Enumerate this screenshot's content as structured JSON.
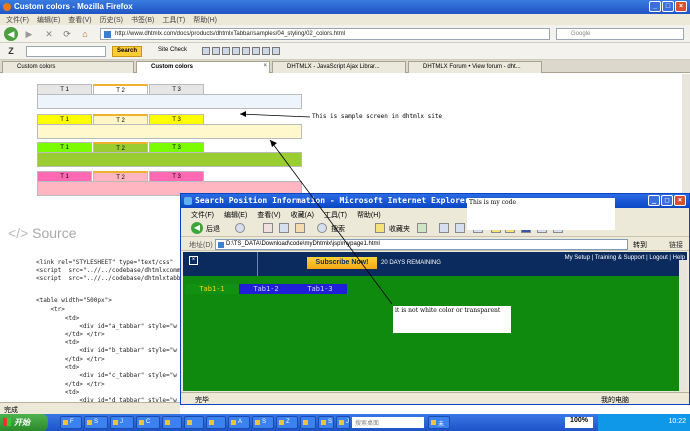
{
  "firefox": {
    "title": "Custom colors - Mozilla Firefox",
    "menu": [
      "文件(F)",
      "编辑(E)",
      "查看(V)",
      "历史(S)",
      "书签(B)",
      "工具(T)",
      "帮助(H)"
    ],
    "url": "http://www.dhtmlx.com/docs/products/dhtmlxTabbar/samples/04_styling/02_colors.html",
    "search_placeholder": "Google",
    "toolbar": {
      "search_button": "Search",
      "site_check": "Site Check"
    },
    "tabs": [
      {
        "label": "Custom colors",
        "active": false
      },
      {
        "label": "Custom colors",
        "active": true
      },
      {
        "label": "DHTMLX - JavaScript Ajax Librar...",
        "active": false
      },
      {
        "label": "DHTMLX Forum • View forum - dht...",
        "active": false
      }
    ],
    "status": "完成"
  },
  "page": {
    "sample_tabbars": [
      {
        "tabs": [
          "T 1",
          "T 2",
          "T 3"
        ],
        "tab_color": "#e6e6e6",
        "active_tab": "#ffffff",
        "body_color": "#eef4fb"
      },
      {
        "tabs": [
          "T 1",
          "T 2",
          "T 3"
        ],
        "tab_color": "#ffff00",
        "active_tab": "#fff6c8",
        "body_color": "#fff8cc"
      },
      {
        "tabs": [
          "T 1",
          "T 2",
          "T 3"
        ],
        "tab_color": "#7cfc00",
        "active_tab": "#9acd32",
        "body_color": "#9acd32"
      },
      {
        "tabs": [
          "T 1",
          "T 2",
          "T 3"
        ],
        "tab_color": "#ff69b4",
        "active_tab": "#ffb6c1",
        "body_color": "#ffb6c1"
      }
    ],
    "note": "This is sample screen in dhtmlx site",
    "source_heading": "Source",
    "code_lines": [
      "<link rel=\"STYLESHEET\" type=\"text/css\"",
      "<script  src=\"..//../codebase/dhtmlxcomm",
      "<script  src=\"..//../codebase/dhtmlxtabb",
      "",
      "<table width=\"500px\">",
      "    <tr>",
      "        <td>",
      "            <div id=\"a_tabbar\" style=\"w",
      "        </td> </tr>",
      "        <td>",
      "            <div id=\"b_tabbar\" style=\"w",
      "        </td> </tr>",
      "        <td>",
      "            <div id=\"c_tabbar\" style=\"w",
      "        </td> </tr>",
      "        <td>",
      "            <div id=\"d_tabbar\" style=\"w"
    ]
  },
  "ie": {
    "title": "Search Position Information - Microsoft Internet Explorer",
    "menu": [
      "文件(F)",
      "编辑(E)",
      "查看(V)",
      "收藏(A)",
      "工具(T)",
      "帮助(H)"
    ],
    "back_label": "后退",
    "search_label": "搜索",
    "favorites_label": "收藏夹",
    "address_label": "地址(D)",
    "address": "D:\\TS_DATA\\Download\\code\\myDhtmlx\\jsp\\mypage1.html",
    "go_label": "转到",
    "links_label": "链接",
    "topbar": {
      "subscribe": "Subscribe Now!",
      "remaining": "20 DAYS REMAINING",
      "links": "My Setup | Training & Support | Logout | Help"
    },
    "tabs": [
      "Tab1-1",
      "Tab1-2",
      "Tab1-3"
    ],
    "content_note": "it is not white color or transparent",
    "my_code_note": "This is my code",
    "status_done": "完毕",
    "status_zone": "我的电脑"
  },
  "taskbar": {
    "start_label": "开始",
    "items": [
      "F",
      "S",
      "J",
      "C",
      "",
      "",
      "",
      "A",
      "S",
      "Z",
      "",
      "S",
      "J",
      "未"
    ],
    "search_placeholder": "搜索桌面",
    "zoom": "100%",
    "clock": "10:22"
  }
}
